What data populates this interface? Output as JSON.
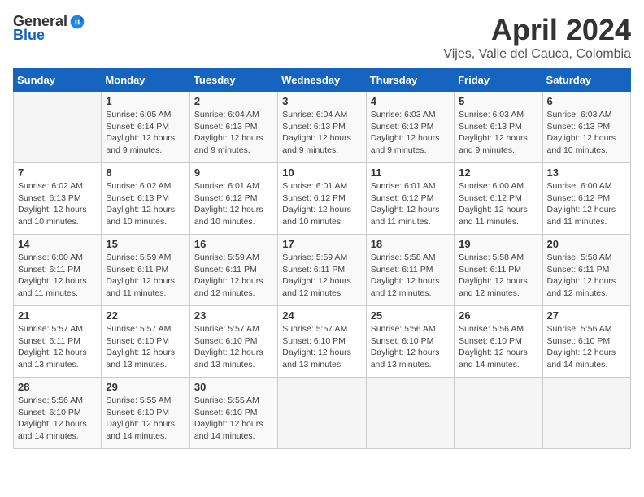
{
  "header": {
    "logo_general": "General",
    "logo_blue": "Blue",
    "month_title": "April 2024",
    "subtitle": "Vijes, Valle del Cauca, Colombia"
  },
  "days_of_week": [
    "Sunday",
    "Monday",
    "Tuesday",
    "Wednesday",
    "Thursday",
    "Friday",
    "Saturday"
  ],
  "weeks": [
    [
      {
        "day": "",
        "content": ""
      },
      {
        "day": "1",
        "content": "Sunrise: 6:05 AM\nSunset: 6:14 PM\nDaylight: 12 hours\nand 9 minutes."
      },
      {
        "day": "2",
        "content": "Sunrise: 6:04 AM\nSunset: 6:13 PM\nDaylight: 12 hours\nand 9 minutes."
      },
      {
        "day": "3",
        "content": "Sunrise: 6:04 AM\nSunset: 6:13 PM\nDaylight: 12 hours\nand 9 minutes."
      },
      {
        "day": "4",
        "content": "Sunrise: 6:03 AM\nSunset: 6:13 PM\nDaylight: 12 hours\nand 9 minutes."
      },
      {
        "day": "5",
        "content": "Sunrise: 6:03 AM\nSunset: 6:13 PM\nDaylight: 12 hours\nand 9 minutes."
      },
      {
        "day": "6",
        "content": "Sunrise: 6:03 AM\nSunset: 6:13 PM\nDaylight: 12 hours\nand 10 minutes."
      }
    ],
    [
      {
        "day": "7",
        "content": "Sunrise: 6:02 AM\nSunset: 6:13 PM\nDaylight: 12 hours\nand 10 minutes."
      },
      {
        "day": "8",
        "content": "Sunrise: 6:02 AM\nSunset: 6:13 PM\nDaylight: 12 hours\nand 10 minutes."
      },
      {
        "day": "9",
        "content": "Sunrise: 6:01 AM\nSunset: 6:12 PM\nDaylight: 12 hours\nand 10 minutes."
      },
      {
        "day": "10",
        "content": "Sunrise: 6:01 AM\nSunset: 6:12 PM\nDaylight: 12 hours\nand 10 minutes."
      },
      {
        "day": "11",
        "content": "Sunrise: 6:01 AM\nSunset: 6:12 PM\nDaylight: 12 hours\nand 11 minutes."
      },
      {
        "day": "12",
        "content": "Sunrise: 6:00 AM\nSunset: 6:12 PM\nDaylight: 12 hours\nand 11 minutes."
      },
      {
        "day": "13",
        "content": "Sunrise: 6:00 AM\nSunset: 6:12 PM\nDaylight: 12 hours\nand 11 minutes."
      }
    ],
    [
      {
        "day": "14",
        "content": "Sunrise: 6:00 AM\nSunset: 6:11 PM\nDaylight: 12 hours\nand 11 minutes."
      },
      {
        "day": "15",
        "content": "Sunrise: 5:59 AM\nSunset: 6:11 PM\nDaylight: 12 hours\nand 11 minutes."
      },
      {
        "day": "16",
        "content": "Sunrise: 5:59 AM\nSunset: 6:11 PM\nDaylight: 12 hours\nand 12 minutes."
      },
      {
        "day": "17",
        "content": "Sunrise: 5:59 AM\nSunset: 6:11 PM\nDaylight: 12 hours\nand 12 minutes."
      },
      {
        "day": "18",
        "content": "Sunrise: 5:58 AM\nSunset: 6:11 PM\nDaylight: 12 hours\nand 12 minutes."
      },
      {
        "day": "19",
        "content": "Sunrise: 5:58 AM\nSunset: 6:11 PM\nDaylight: 12 hours\nand 12 minutes."
      },
      {
        "day": "20",
        "content": "Sunrise: 5:58 AM\nSunset: 6:11 PM\nDaylight: 12 hours\nand 12 minutes."
      }
    ],
    [
      {
        "day": "21",
        "content": "Sunrise: 5:57 AM\nSunset: 6:11 PM\nDaylight: 12 hours\nand 13 minutes."
      },
      {
        "day": "22",
        "content": "Sunrise: 5:57 AM\nSunset: 6:10 PM\nDaylight: 12 hours\nand 13 minutes."
      },
      {
        "day": "23",
        "content": "Sunrise: 5:57 AM\nSunset: 6:10 PM\nDaylight: 12 hours\nand 13 minutes."
      },
      {
        "day": "24",
        "content": "Sunrise: 5:57 AM\nSunset: 6:10 PM\nDaylight: 12 hours\nand 13 minutes."
      },
      {
        "day": "25",
        "content": "Sunrise: 5:56 AM\nSunset: 6:10 PM\nDaylight: 12 hours\nand 13 minutes."
      },
      {
        "day": "26",
        "content": "Sunrise: 5:56 AM\nSunset: 6:10 PM\nDaylight: 12 hours\nand 14 minutes."
      },
      {
        "day": "27",
        "content": "Sunrise: 5:56 AM\nSunset: 6:10 PM\nDaylight: 12 hours\nand 14 minutes."
      }
    ],
    [
      {
        "day": "28",
        "content": "Sunrise: 5:56 AM\nSunset: 6:10 PM\nDaylight: 12 hours\nand 14 minutes."
      },
      {
        "day": "29",
        "content": "Sunrise: 5:55 AM\nSunset: 6:10 PM\nDaylight: 12 hours\nand 14 minutes."
      },
      {
        "day": "30",
        "content": "Sunrise: 5:55 AM\nSunset: 6:10 PM\nDaylight: 12 hours\nand 14 minutes."
      },
      {
        "day": "",
        "content": ""
      },
      {
        "day": "",
        "content": ""
      },
      {
        "day": "",
        "content": ""
      },
      {
        "day": "",
        "content": ""
      }
    ]
  ]
}
